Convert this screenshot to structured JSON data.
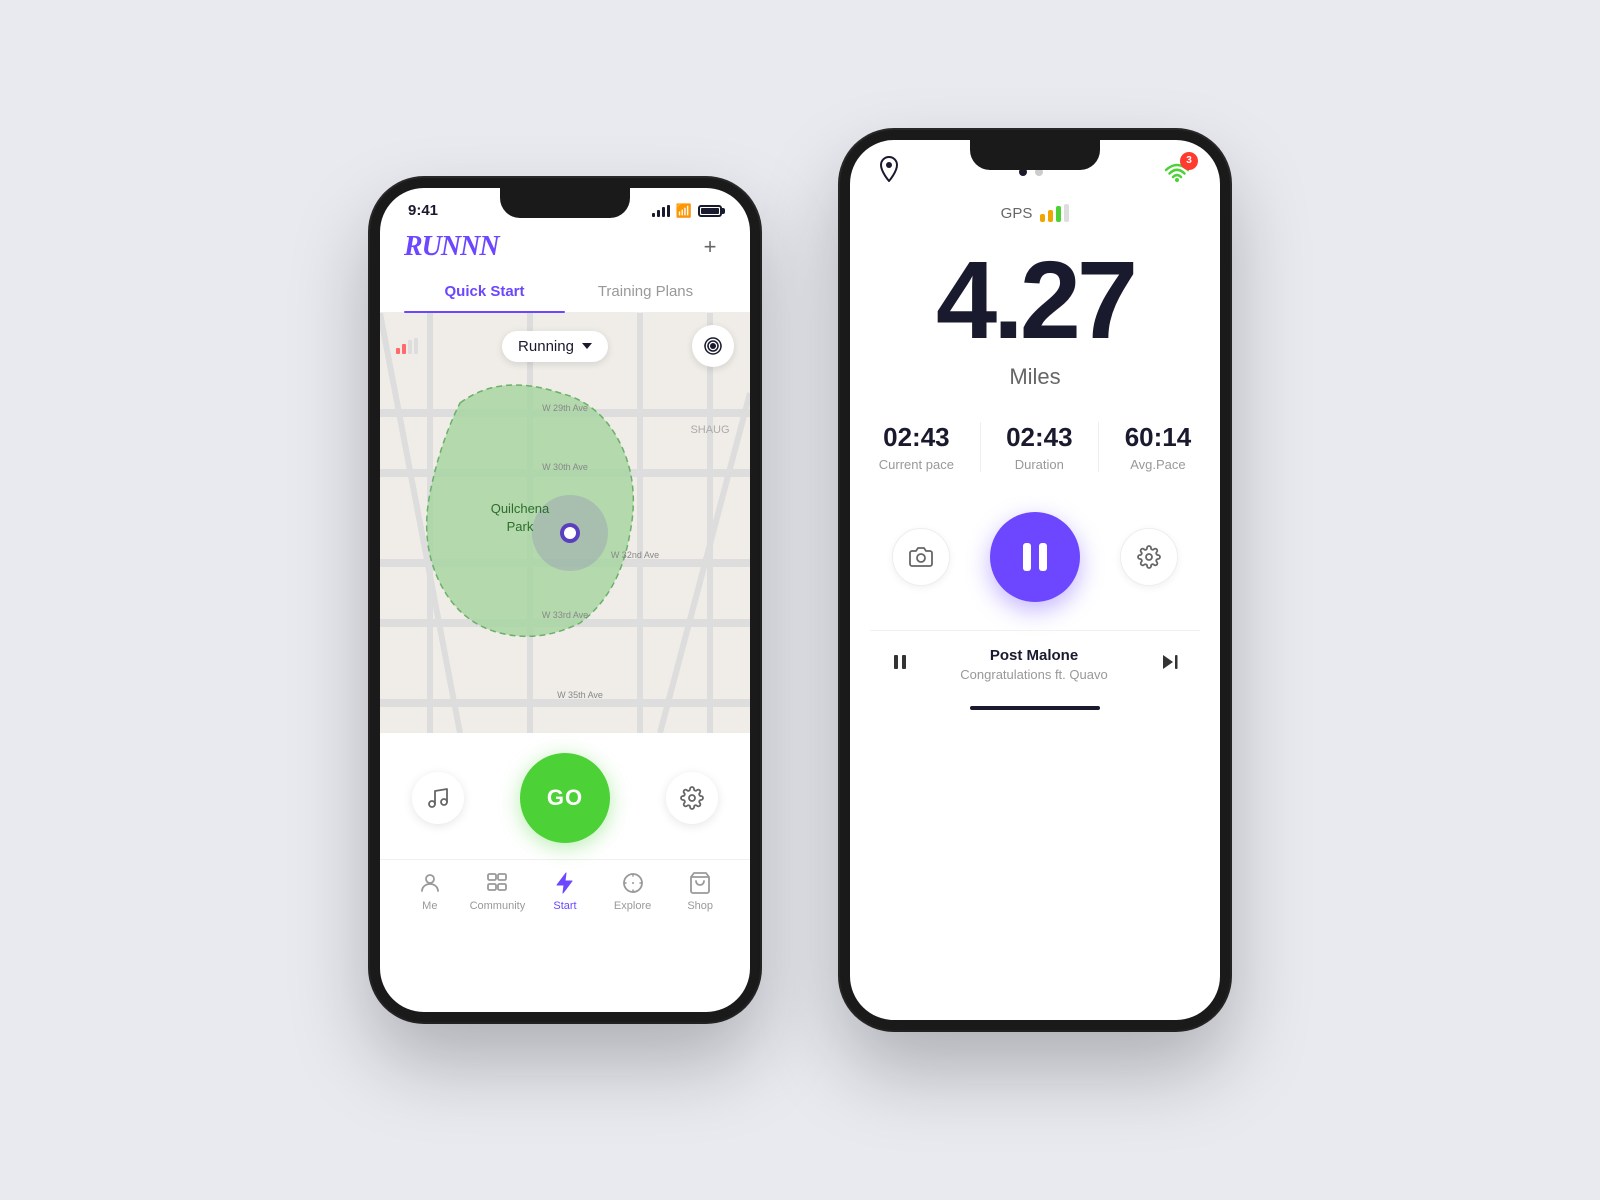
{
  "background": "#e8eaf0",
  "phone1": {
    "status_time": "9:41",
    "logo": "RUNNN",
    "add_label": "+",
    "tabs": [
      {
        "label": "Quick Start",
        "active": true
      },
      {
        "label": "Training Plans",
        "active": false
      }
    ],
    "activity_type": "Running",
    "map": {
      "park_name": "Quilchena Park",
      "street_labels": [
        "W 29th Ave",
        "W 30th Ave",
        "W 32nd Ave",
        "W 33rd Ave",
        "W 35th Ave",
        "SHAUG"
      ]
    },
    "go_button": "GO",
    "nav_items": [
      {
        "label": "Me",
        "icon": "person"
      },
      {
        "label": "Community",
        "icon": "community"
      },
      {
        "label": "Start",
        "icon": "lightning",
        "active": true
      },
      {
        "label": "Explore",
        "icon": "compass"
      },
      {
        "label": "Shop",
        "icon": "bag"
      }
    ]
  },
  "phone2": {
    "gps_label": "GPS",
    "distance_value": "4.27",
    "distance_unit": "Miles",
    "stats": [
      {
        "label": "Current pace",
        "value": "02:43"
      },
      {
        "label": "Duration",
        "value": "02:43"
      },
      {
        "label": "Avg.Pace",
        "value": "60:14"
      }
    ],
    "music": {
      "artist": "Post Malone",
      "song": "Congratulations ft. Quavo"
    },
    "badge_count": "3",
    "dots": [
      "#1a1a2e",
      "#999"
    ]
  }
}
